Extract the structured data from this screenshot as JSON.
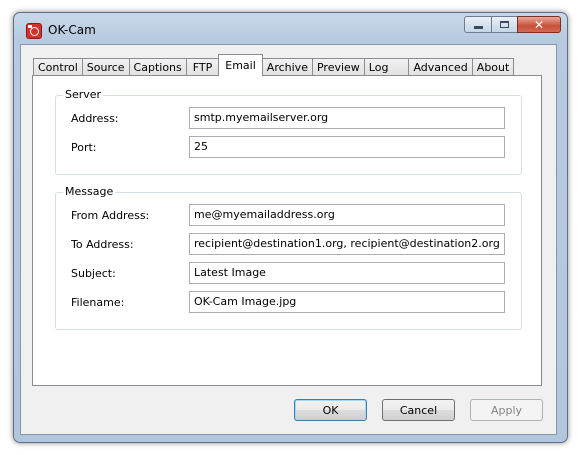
{
  "window": {
    "title": "OK-Cam"
  },
  "tabs": [
    {
      "label": "Control"
    },
    {
      "label": "Source"
    },
    {
      "label": "Captions"
    },
    {
      "label": "FTP"
    },
    {
      "label": "Email"
    },
    {
      "label": "Archive"
    },
    {
      "label": "Preview"
    },
    {
      "label": "Log"
    },
    {
      "label": "Advanced"
    },
    {
      "label": "About"
    }
  ],
  "active_tab": "Email",
  "server": {
    "group_title": "Server",
    "address_label": "Address:",
    "address_value": "smtp.myemailserver.org",
    "port_label": "Port:",
    "port_value": "25"
  },
  "message": {
    "group_title": "Message",
    "from_label": "From Address:",
    "from_value": "me@myemailaddress.org",
    "to_label": "To Address:",
    "to_value": "recipient@destination1.org, recipient@destination2.org",
    "subject_label": "Subject:",
    "subject_value": "Latest Image",
    "filename_label": "Filename:",
    "filename_value": "OK-Cam Image.jpg"
  },
  "buttons": {
    "ok": "OK",
    "cancel": "Cancel",
    "apply": "Apply"
  }
}
